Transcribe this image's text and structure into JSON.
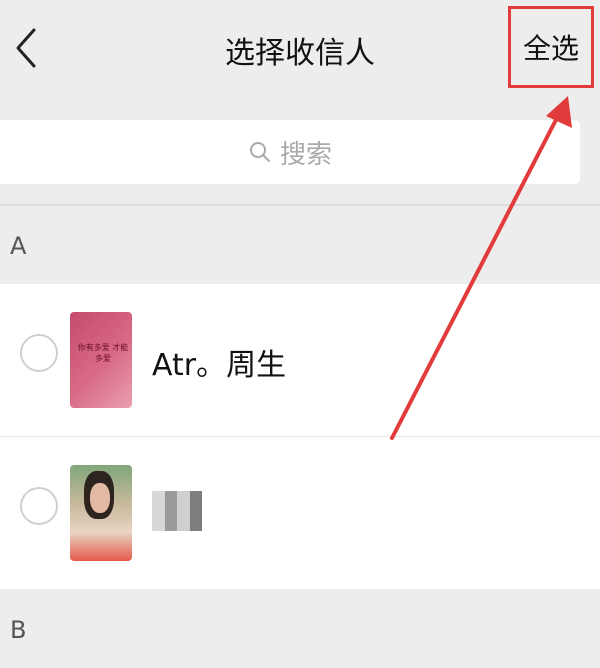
{
  "nav": {
    "title": "选择收信人",
    "select_all": "全选",
    "back_icon": "chevron-left-icon"
  },
  "search": {
    "placeholder": "搜索",
    "icon": "search-icon"
  },
  "sections": [
    {
      "letter": "A"
    },
    {
      "letter": "B"
    }
  ],
  "contacts": [
    {
      "name": "Atr。周生",
      "selected": false,
      "avatar_text": "你有多爱 才能多爱"
    },
    {
      "name": "",
      "selected": false
    }
  ],
  "colors": {
    "highlight": "#e23b3b",
    "background": "#ededed"
  }
}
